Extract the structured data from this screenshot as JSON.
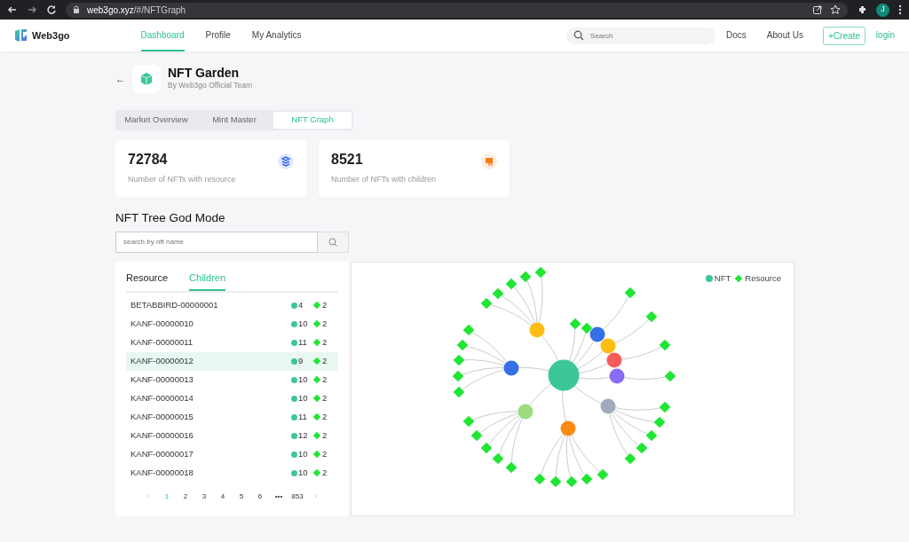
{
  "browser": {
    "url_host": "web3go.xyz",
    "url_path": "/#/NFTGraph",
    "profile_initial": "J"
  },
  "navbar": {
    "brand": "Web3go",
    "links": [
      {
        "label": "Dashboard",
        "selected": true
      },
      {
        "label": "Profile",
        "selected": false
      },
      {
        "label": "My Analytics",
        "selected": false
      }
    ],
    "search": {
      "placeholder": "Search"
    },
    "right_links": [
      "Docs",
      "About Us"
    ],
    "create_button": "Create",
    "create_plus": "+",
    "login": "login"
  },
  "header": {
    "back": "←",
    "title": "NFT Garden",
    "subtitle": "By Web3go Official Team"
  },
  "tabs": [
    {
      "label": "Market Overview",
      "selected": false
    },
    {
      "label": "Mint Master",
      "selected": false
    },
    {
      "label": "NFT Graph",
      "selected": true
    }
  ],
  "stats": [
    {
      "value": "72784",
      "label": "Number of NFTs with resource",
      "kind": "stack"
    },
    {
      "value": "8521",
      "label": "Number of NFTs with children",
      "kind": "tree"
    }
  ],
  "section_title": "NFT Tree God Mode",
  "nft_search": {
    "placeholder": "search by nft name"
  },
  "list_tabs": [
    {
      "label": "Resource",
      "selected": false
    },
    {
      "label": "Children",
      "selected": true
    }
  ],
  "nft_rows": [
    {
      "name": "BETABBIRD-00000001",
      "children": "4",
      "resources": "2",
      "selected": false
    },
    {
      "name": "KANF-00000010",
      "children": "10",
      "resources": "2",
      "selected": false
    },
    {
      "name": "KANF-00000011",
      "children": "11",
      "resources": "2",
      "selected": false
    },
    {
      "name": "KANF-00000012",
      "children": "9",
      "resources": "2",
      "selected": true
    },
    {
      "name": "KANF-00000013",
      "children": "10",
      "resources": "2",
      "selected": false
    },
    {
      "name": "KANF-00000014",
      "children": "10",
      "resources": "2",
      "selected": false
    },
    {
      "name": "KANF-00000015",
      "children": "11",
      "resources": "2",
      "selected": false
    },
    {
      "name": "KANF-00000016",
      "children": "12",
      "resources": "2",
      "selected": false
    },
    {
      "name": "KANF-00000017",
      "children": "10",
      "resources": "2",
      "selected": false
    },
    {
      "name": "KANF-00000018",
      "children": "10",
      "resources": "2",
      "selected": false
    }
  ],
  "pagination": {
    "prev": "‹",
    "next": "›",
    "pages": [
      {
        "label": "1",
        "selected": true
      },
      {
        "label": "2",
        "selected": false
      },
      {
        "label": "3",
        "selected": false
      },
      {
        "label": "4",
        "selected": false
      },
      {
        "label": "5",
        "selected": false
      },
      {
        "label": "6",
        "selected": false
      },
      {
        "label": "•••",
        "selected": false
      },
      {
        "label": "853",
        "selected": false
      }
    ]
  },
  "graph": {
    "legend": [
      {
        "label": "NFT",
        "kind": "circle",
        "color": "#3cc896"
      },
      {
        "label": "Resource",
        "kind": "diamond",
        "color": "#1ee632"
      }
    ]
  }
}
